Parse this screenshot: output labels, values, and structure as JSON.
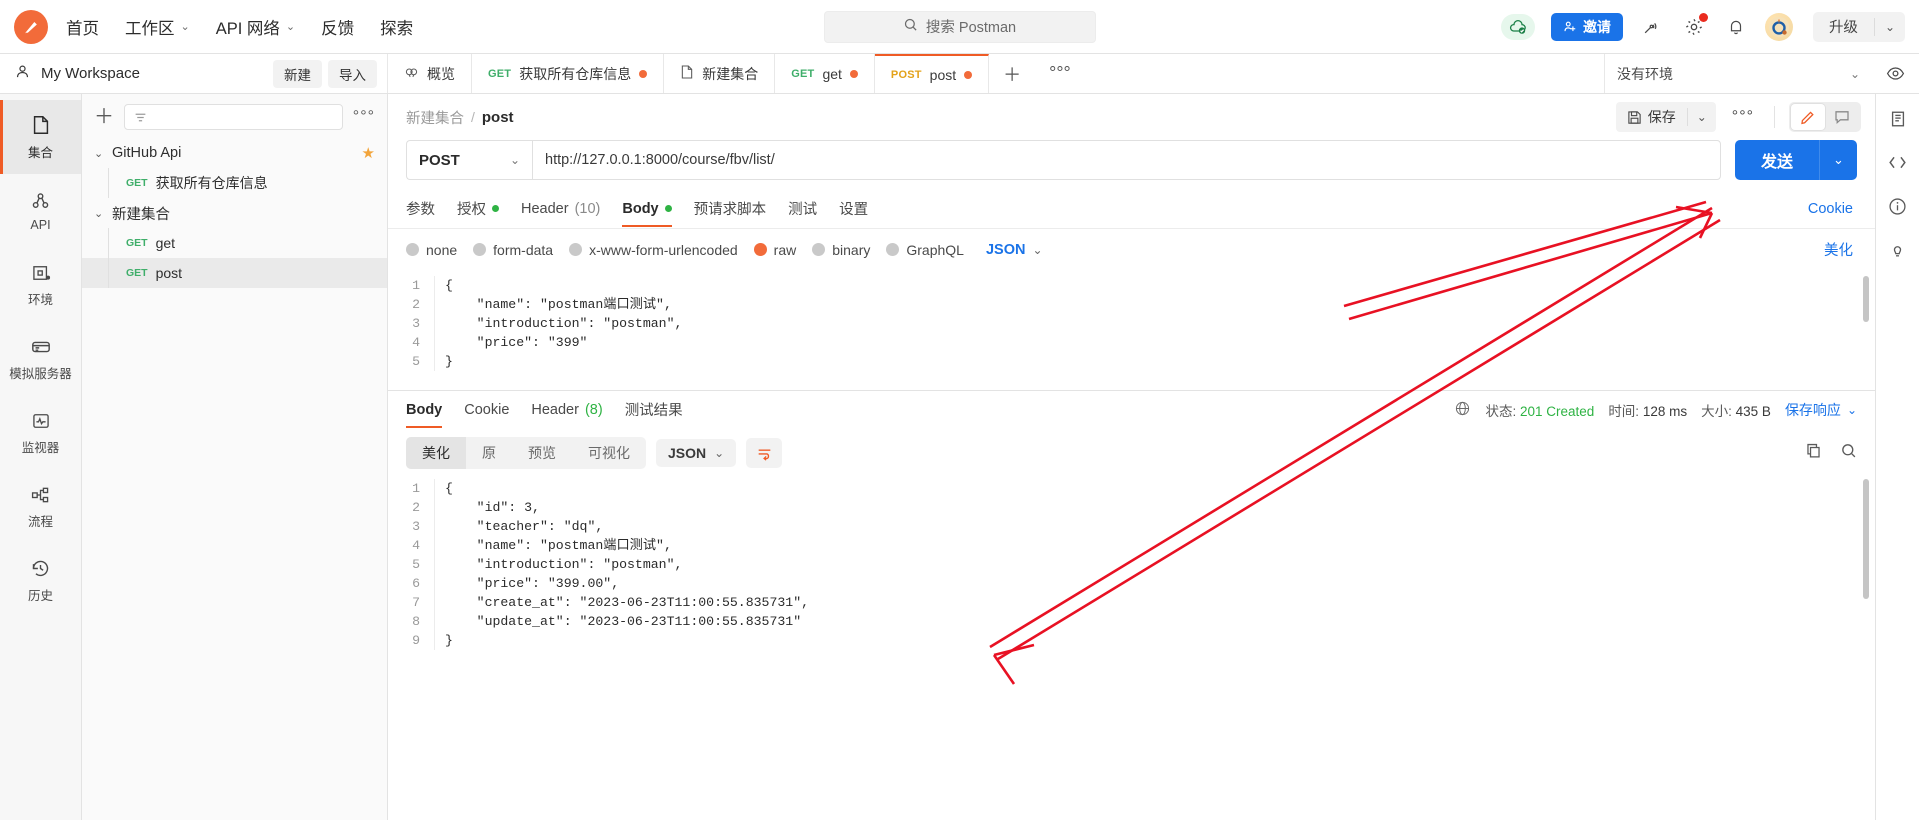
{
  "header": {
    "nav": [
      {
        "label": "首页",
        "caret": false
      },
      {
        "label": "工作区",
        "caret": true
      },
      {
        "label": "API 网络",
        "caret": true
      },
      {
        "label": "反馈",
        "caret": false
      },
      {
        "label": "探索",
        "caret": false
      }
    ],
    "search_placeholder": "搜索 Postman",
    "invite_label": "邀请",
    "upgrade_label": "升级",
    "icons": [
      "cloud-check-icon",
      "satellite-icon",
      "gear-icon",
      "bell-icon",
      "avatar"
    ]
  },
  "workspace": {
    "name": "My Workspace",
    "new_label": "新建",
    "import_label": "导入"
  },
  "tabs": [
    {
      "icon": "overview-icon",
      "method": "",
      "label": "概览",
      "unsaved": false,
      "active": false
    },
    {
      "icon": "",
      "method": "GET",
      "label": "获取所有仓库信息",
      "unsaved": true,
      "active": false
    },
    {
      "icon": "collection-icon",
      "method": "",
      "label": "新建集合",
      "unsaved": false,
      "active": false
    },
    {
      "icon": "",
      "method": "GET",
      "label": "get",
      "unsaved": true,
      "active": false
    },
    {
      "icon": "",
      "method": "POST",
      "label": "post",
      "unsaved": true,
      "active": true
    }
  ],
  "environment": {
    "selected": "没有环境"
  },
  "rail": [
    {
      "icon": "collection-icon",
      "label": "集合",
      "active": true
    },
    {
      "icon": "api-icon",
      "label": "API",
      "active": false
    },
    {
      "icon": "environment-icon",
      "label": "环境",
      "active": false
    },
    {
      "icon": "mock-server-icon",
      "label": "模拟服务器",
      "active": false
    },
    {
      "icon": "monitor-icon",
      "label": "监视器",
      "active": false
    },
    {
      "icon": "flow-icon",
      "label": "流程",
      "active": false
    },
    {
      "icon": "history-icon",
      "label": "历史",
      "active": false
    }
  ],
  "collections": {
    "filter_placeholder": "",
    "tree": [
      {
        "type": "folder",
        "label": "GitHub Api",
        "starred": true,
        "expanded": true,
        "selected": false
      },
      {
        "type": "request",
        "method": "GET",
        "label": "获取所有仓库信息",
        "selected": false
      },
      {
        "type": "folder",
        "label": "新建集合",
        "starred": false,
        "expanded": true,
        "selected": false
      },
      {
        "type": "request",
        "method": "GET",
        "label": "get",
        "selected": false
      },
      {
        "type": "request",
        "method": "GET",
        "label": "post",
        "selected": true
      }
    ]
  },
  "request": {
    "breadcrumb_parent": "新建集合",
    "breadcrumb_sep": "/",
    "breadcrumb_current": "post",
    "save_label": "保存",
    "method": "POST",
    "url": "http://127.0.0.1:8000/course/fbv/list/",
    "send_label": "发送",
    "tabs": [
      {
        "label": "参数",
        "dot": false,
        "count": "",
        "active": false
      },
      {
        "label": "授权",
        "dot": true,
        "count": "",
        "active": false
      },
      {
        "label": "Header",
        "dot": false,
        "count": "(10)",
        "active": false
      },
      {
        "label": "Body",
        "dot": true,
        "count": "",
        "active": true
      },
      {
        "label": "预请求脚本",
        "dot": false,
        "count": "",
        "active": false
      },
      {
        "label": "测试",
        "dot": false,
        "count": "",
        "active": false
      },
      {
        "label": "设置",
        "dot": false,
        "count": "",
        "active": false
      }
    ],
    "cookie_link": "Cookie",
    "body_types": [
      {
        "label": "none",
        "selected": false
      },
      {
        "label": "form-data",
        "selected": false
      },
      {
        "label": "x-www-form-urlencoded",
        "selected": false
      },
      {
        "label": "raw",
        "selected": true
      },
      {
        "label": "binary",
        "selected": false
      },
      {
        "label": "GraphQL",
        "selected": false
      }
    ],
    "body_format": "JSON",
    "beautify_label": "美化",
    "body_lines": [
      {
        "n": "1",
        "text": "{"
      },
      {
        "n": "2",
        "text": "    \"name\": \"postman端口测试\","
      },
      {
        "n": "3",
        "text": "    \"introduction\": \"postman\","
      },
      {
        "n": "4",
        "text": "    \"price\": \"399\""
      },
      {
        "n": "5",
        "text": "}"
      }
    ]
  },
  "response": {
    "tabs": [
      {
        "label": "Body",
        "count": "",
        "active": true
      },
      {
        "label": "Cookie",
        "count": "",
        "active": false
      },
      {
        "label": "Header",
        "count": "(8)",
        "active": false
      },
      {
        "label": "测试结果",
        "count": "",
        "active": false
      }
    ],
    "status_label": "状态:",
    "status_value": "201 Created",
    "time_label": "时间:",
    "time_value": "128 ms",
    "size_label": "大小:",
    "size_value": "435 B",
    "save_response_label": "保存响应",
    "view_modes": [
      {
        "label": "美化",
        "active": true
      },
      {
        "label": "原",
        "active": false
      },
      {
        "label": "预览",
        "active": false
      },
      {
        "label": "可视化",
        "active": false
      }
    ],
    "format": "JSON",
    "body_lines": [
      {
        "n": "1",
        "text": "{"
      },
      {
        "n": "2",
        "text": "    \"id\": 3,"
      },
      {
        "n": "3",
        "text": "    \"teacher\": \"dq\","
      },
      {
        "n": "4",
        "text": "    \"name\": \"postman端口测试\","
      },
      {
        "n": "5",
        "text": "    \"introduction\": \"postman\","
      },
      {
        "n": "6",
        "text": "    \"price\": \"399.00\","
      },
      {
        "n": "7",
        "text": "    \"create_at\": \"2023-06-23T11:00:55.835731\","
      },
      {
        "n": "8",
        "text": "    \"update_at\": \"2023-06-23T11:00:55.835731\""
      },
      {
        "n": "9",
        "text": "}"
      }
    ]
  },
  "colors": {
    "brand_orange": "#ef5b25",
    "blue": "#1a73e8",
    "green": "#2fb344",
    "annotation_red": "#e81123"
  }
}
